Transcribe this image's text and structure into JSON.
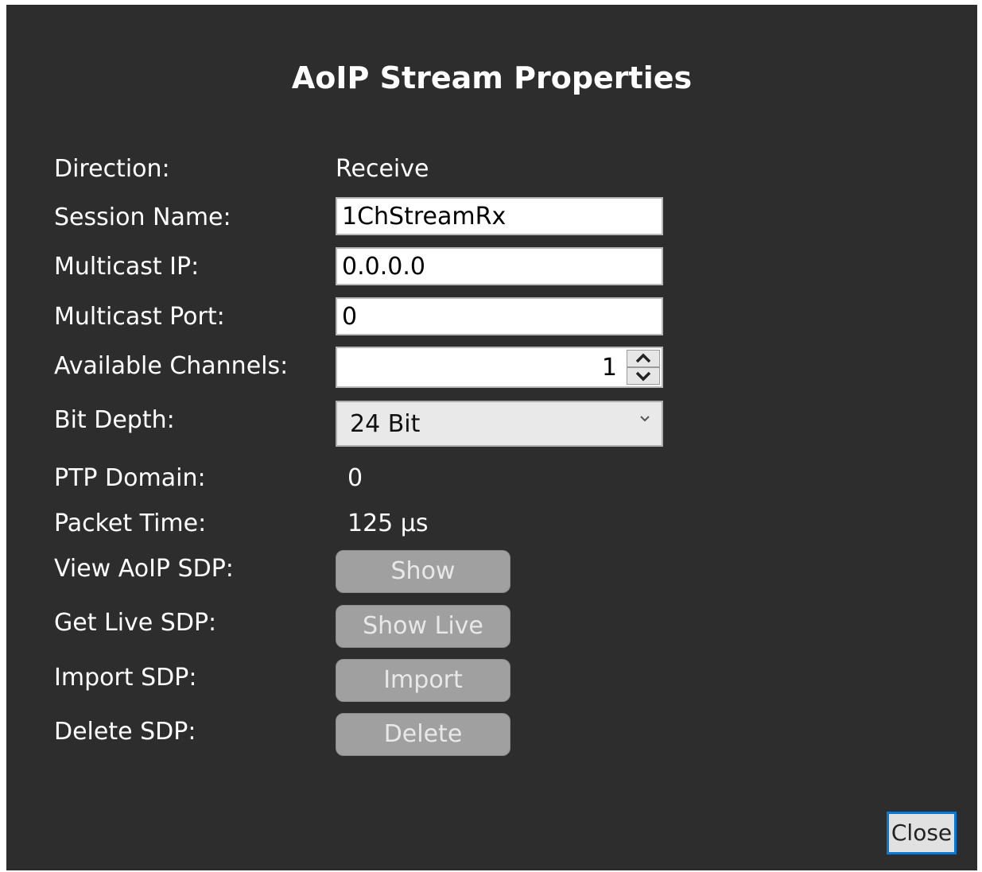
{
  "dialog": {
    "title": "AoIP Stream Properties"
  },
  "fields": {
    "direction": {
      "label": "Direction:",
      "value": "Receive"
    },
    "session_name": {
      "label": "Session Name:",
      "value": "1ChStreamRx"
    },
    "multicast_ip": {
      "label": "Multicast IP:",
      "value": "0.0.0.0"
    },
    "multicast_port": {
      "label": "Multicast Port:",
      "value": "0"
    },
    "available_channels": {
      "label": "Available Channels:",
      "value": "1"
    },
    "bit_depth": {
      "label": "Bit Depth:",
      "value": "24 Bit"
    },
    "ptp_domain": {
      "label": "PTP Domain:",
      "value": "0"
    },
    "packet_time": {
      "label": "Packet Time:",
      "value": "125 µs"
    }
  },
  "actions": {
    "view_sdp": {
      "label": "View AoIP SDP:",
      "button": "Show"
    },
    "get_live_sdp": {
      "label": "Get Live SDP:",
      "button": "Show Live"
    },
    "import_sdp": {
      "label": "Import SDP:",
      "button": "Import"
    },
    "delete_sdp": {
      "label": "Delete SDP:",
      "button": "Delete"
    }
  },
  "footer": {
    "close": "Close"
  },
  "icons": {
    "spin_up": "chevron-up-icon",
    "spin_down": "chevron-down-icon",
    "dropdown": "chevron-down-icon"
  },
  "colors": {
    "background": "#2d2d2d",
    "button_disabled": "#a0a0a0",
    "focus_border": "#0078d7"
  }
}
